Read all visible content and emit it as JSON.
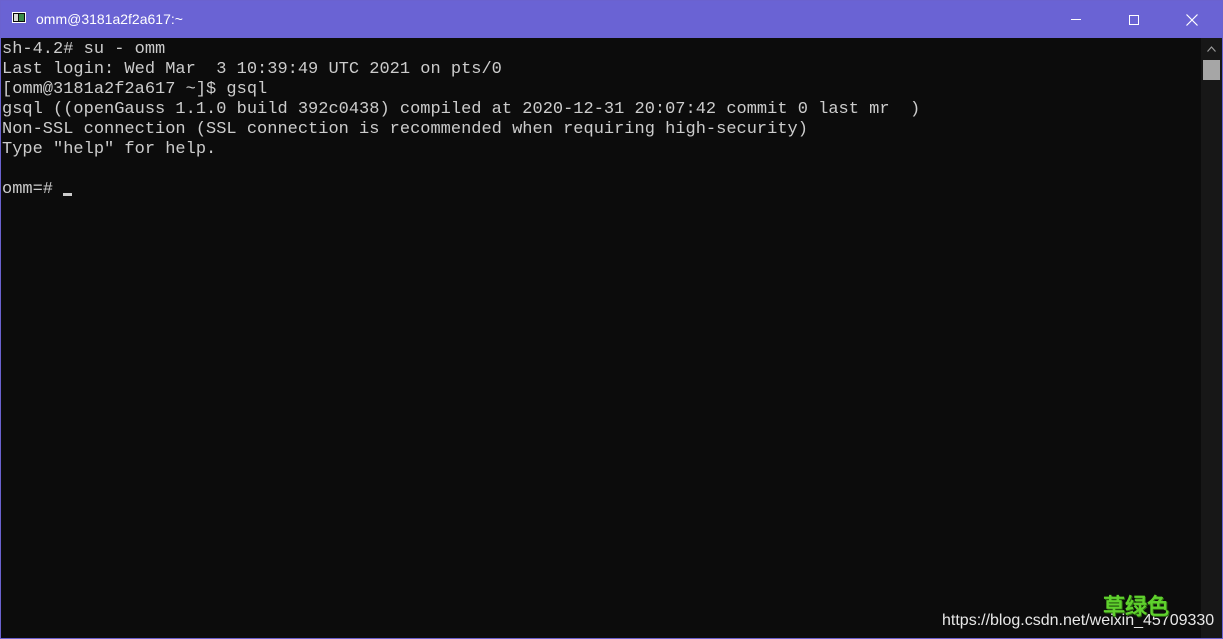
{
  "window": {
    "title": "omm@3181a2f2a617:~",
    "icon": "terminal-app-icon",
    "controls": {
      "minimize_icon": "minimize-icon",
      "maximize_icon": "maximize-icon",
      "close_icon": "close-icon"
    },
    "colors": {
      "titlebar": "#6a63d4",
      "terminal_bg": "#0c0c0c",
      "terminal_fg": "#cccccc"
    }
  },
  "terminal": {
    "lines": [
      "sh-4.2# su - omm",
      "Last login: Wed Mar  3 10:39:49 UTC 2021 on pts/0",
      "[omm@3181a2f2a617 ~]$ gsql",
      "gsql ((openGauss 1.1.0 build 392c0438) compiled at 2020-12-31 20:07:42 commit 0 last mr  )",
      "Non-SSL connection (SSL connection is recommended when requiring high-security)",
      "Type \"help\" for help.",
      ""
    ],
    "prompt": "omm=# "
  },
  "watermark": {
    "brand": "草绿色",
    "url": "https://blog.csdn.net/weixin_45709330"
  }
}
